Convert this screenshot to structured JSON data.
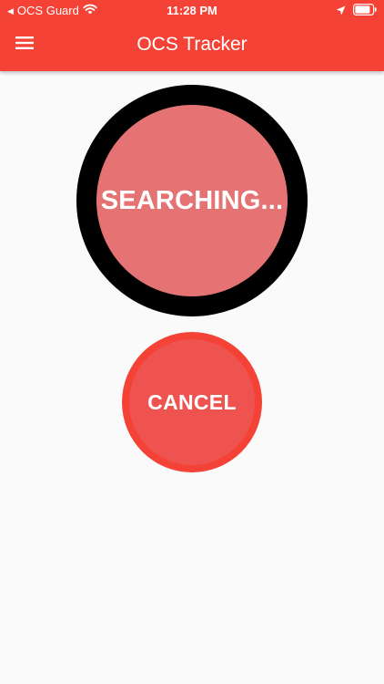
{
  "status_bar": {
    "back_app": "OCS Guard",
    "time": "11:28 PM",
    "icons": [
      "back-caret-icon",
      "wifi-icon",
      "location-arrow-icon",
      "battery-icon"
    ]
  },
  "app_bar": {
    "title": "OCS Tracker",
    "menu_icon": "hamburger-menu-icon",
    "color": "#f44336"
  },
  "main": {
    "search_label": "SEARCHING...",
    "cancel_label": "CANCEL"
  },
  "colors": {
    "accent": "#f44336",
    "indicator_fill": "#e57373",
    "indicator_ring": "#000000",
    "cancel_fill": "#ef5350",
    "background": "#fafafa"
  }
}
